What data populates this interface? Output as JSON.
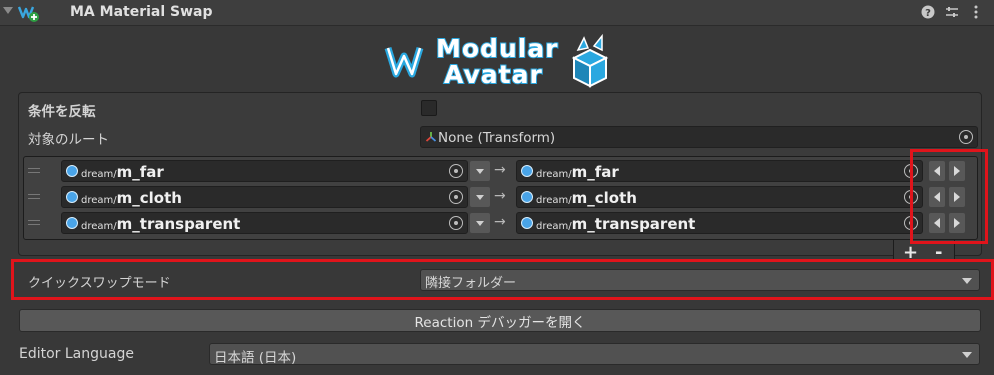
{
  "header": {
    "title": "MA Material Swap",
    "help_icon": "help-icon",
    "settings_icon": "sliders-icon",
    "menu_icon": "kebab-menu-icon"
  },
  "logo": {
    "line1": "Modular",
    "line2": "Avatar",
    "accent_color": "#2aa8e0"
  },
  "fields": {
    "invert_condition_label": "条件を反転",
    "invert_condition_checked": false,
    "root_label": "対象のルート",
    "root_value": "None (Transform)"
  },
  "swaps": [
    {
      "from_prefix": "dream/",
      "from_name": "m_far",
      "arrow": "→",
      "to_prefix": "dream/",
      "to_name": "m_far"
    },
    {
      "from_prefix": "dream/",
      "from_name": "m_cloth",
      "arrow": "→",
      "to_prefix": "dream/",
      "to_name": "m_cloth"
    },
    {
      "from_prefix": "dream/",
      "from_name": "m_transparent",
      "arrow": "→",
      "to_prefix": "dream/",
      "to_name": "m_transparent"
    }
  ],
  "list_controls": {
    "add": "+",
    "remove": "-"
  },
  "quick_swap": {
    "label": "クイックスワップモード",
    "value": "隣接フォルダー"
  },
  "debugger_button": "Reaction デバッガーを開く",
  "language": {
    "label": "Editor Language",
    "value": "日本語 (日本)"
  },
  "highlight_color": "#e0141b"
}
